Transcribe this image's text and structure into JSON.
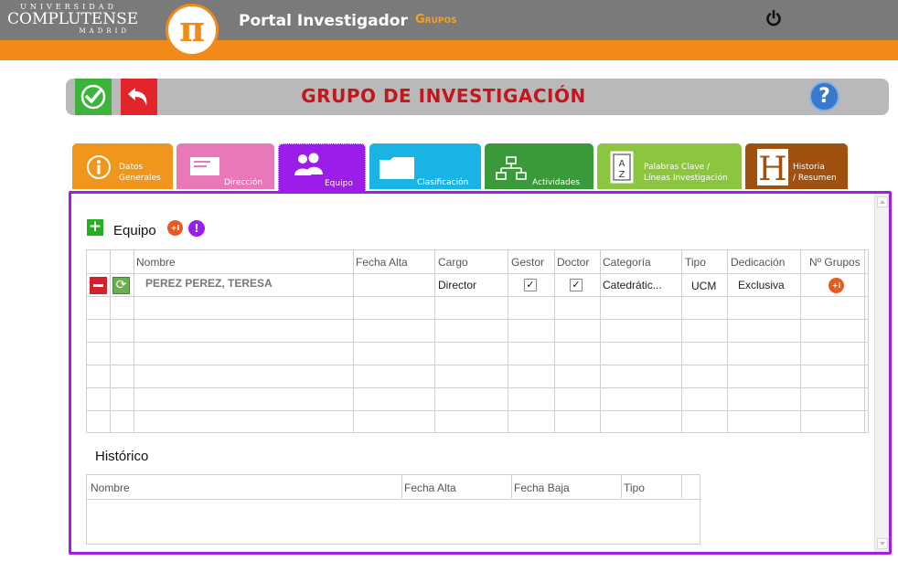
{
  "header": {
    "uni_line1": "UNIVERSIDAD",
    "uni_line2": "COMPLUTENSE",
    "uni_line3": "MADRID",
    "logo_symbol": "π",
    "app_title": "Portal Investigador",
    "section": "Grupos",
    "power_icon": "power-icon"
  },
  "toolbar": {
    "title": "GRUPO DE INVESTIGACIÓN",
    "help_label": "?"
  },
  "tabs": [
    {
      "label_line1": "Datos",
      "label_line2": "Generales",
      "icon": "info-icon"
    },
    {
      "label_line1": "Dirección",
      "label_line2": "",
      "icon": "address-card-icon"
    },
    {
      "label_line1": "Equipo",
      "label_line2": "",
      "icon": "team-icon"
    },
    {
      "label_line1": "Clasificación",
      "label_line2": "",
      "icon": "folder-icon"
    },
    {
      "label_line1": "Actividades",
      "label_line2": "",
      "icon": "hierarchy-icon"
    },
    {
      "label_line1": "Palabras Clave /",
      "label_line2": "Líneas Investigación",
      "icon": "dictionary-icon"
    },
    {
      "label_line1": "Historia",
      "label_line2": "/ Resumen",
      "icon": "history-icon"
    }
  ],
  "equipo": {
    "title": "Equipo",
    "add_label": "+",
    "badge_plus": "+i",
    "badge_info": "!",
    "columns": [
      "Nombre",
      "Fecha Alta",
      "Cargo",
      "Gestor",
      "Doctor",
      "Categoría",
      "Tipo",
      "Dedicación",
      "Nº Grupos"
    ],
    "rows": [
      {
        "nombre": "PEREZ PEREZ, TERESA",
        "fecha_alta": "",
        "cargo": "Director",
        "gestor": true,
        "doctor": true,
        "categoria": "Catedrátic...",
        "tipo": "UCM",
        "dedicacion": "Exclusiva",
        "n_grupos": "+i"
      }
    ],
    "check_mark": "✓"
  },
  "historico": {
    "title": "Histórico",
    "columns": [
      "Nombre",
      "Fecha Alta",
      "Fecha Baja",
      "Tipo"
    ]
  },
  "colors": {
    "topbar": "#7a7a7a",
    "accent_orange": "#f28a1a",
    "title_red": "#c4161c",
    "panel_purple": "#a21ee4"
  }
}
